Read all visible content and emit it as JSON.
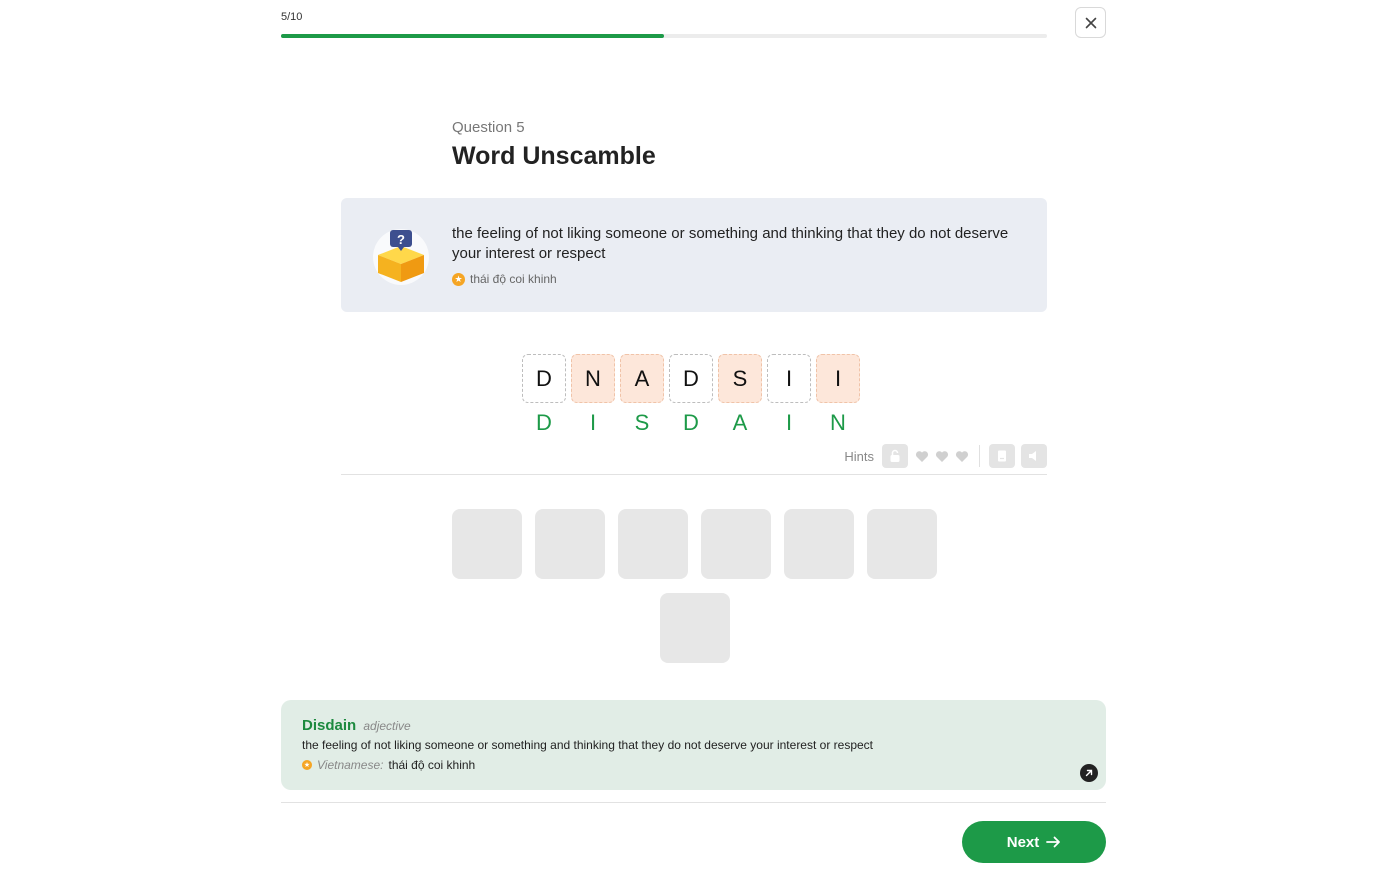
{
  "progress": {
    "label": "5/10",
    "fraction": 0.5
  },
  "question": {
    "number_label": "Question 5",
    "title": "Word Unscamble"
  },
  "definition": {
    "text": "the feeling of not liking someone or something and thinking that they do not deserve your interest or respect",
    "translation": "thái độ coi khinh"
  },
  "scrambled_tiles": [
    {
      "letter": "D",
      "state": "plain"
    },
    {
      "letter": "N",
      "state": "highlighted"
    },
    {
      "letter": "A",
      "state": "highlighted"
    },
    {
      "letter": "D",
      "state": "plain"
    },
    {
      "letter": "S",
      "state": "highlighted"
    },
    {
      "letter": "I",
      "state": "plain"
    },
    {
      "letter": "I",
      "state": "highlighted"
    }
  ],
  "answer_letters": [
    "D",
    "I",
    "S",
    "D",
    "A",
    "I",
    "N"
  ],
  "hints": {
    "label": "Hints",
    "hearts": 3
  },
  "answer_slots": 7,
  "result": {
    "word": "Disdain",
    "part_of_speech": "adjective",
    "definition": "the feeling of not liking someone or something and thinking that they do not deserve your interest or respect",
    "vietnamese_label": "Vietnamese:",
    "vietnamese_value": "thái độ coi khinh"
  },
  "next_button": {
    "label": "Next"
  },
  "colors": {
    "accent": "#1d9a48",
    "tile_highlight": "#fde7da",
    "result_bg": "#e1ede6"
  },
  "icons": [
    "close-icon",
    "mystery-box-icon",
    "star-icon",
    "lock-icon",
    "heart-icon",
    "flashcard-icon",
    "speaker-icon",
    "external-link-icon",
    "arrow-right-icon"
  ]
}
